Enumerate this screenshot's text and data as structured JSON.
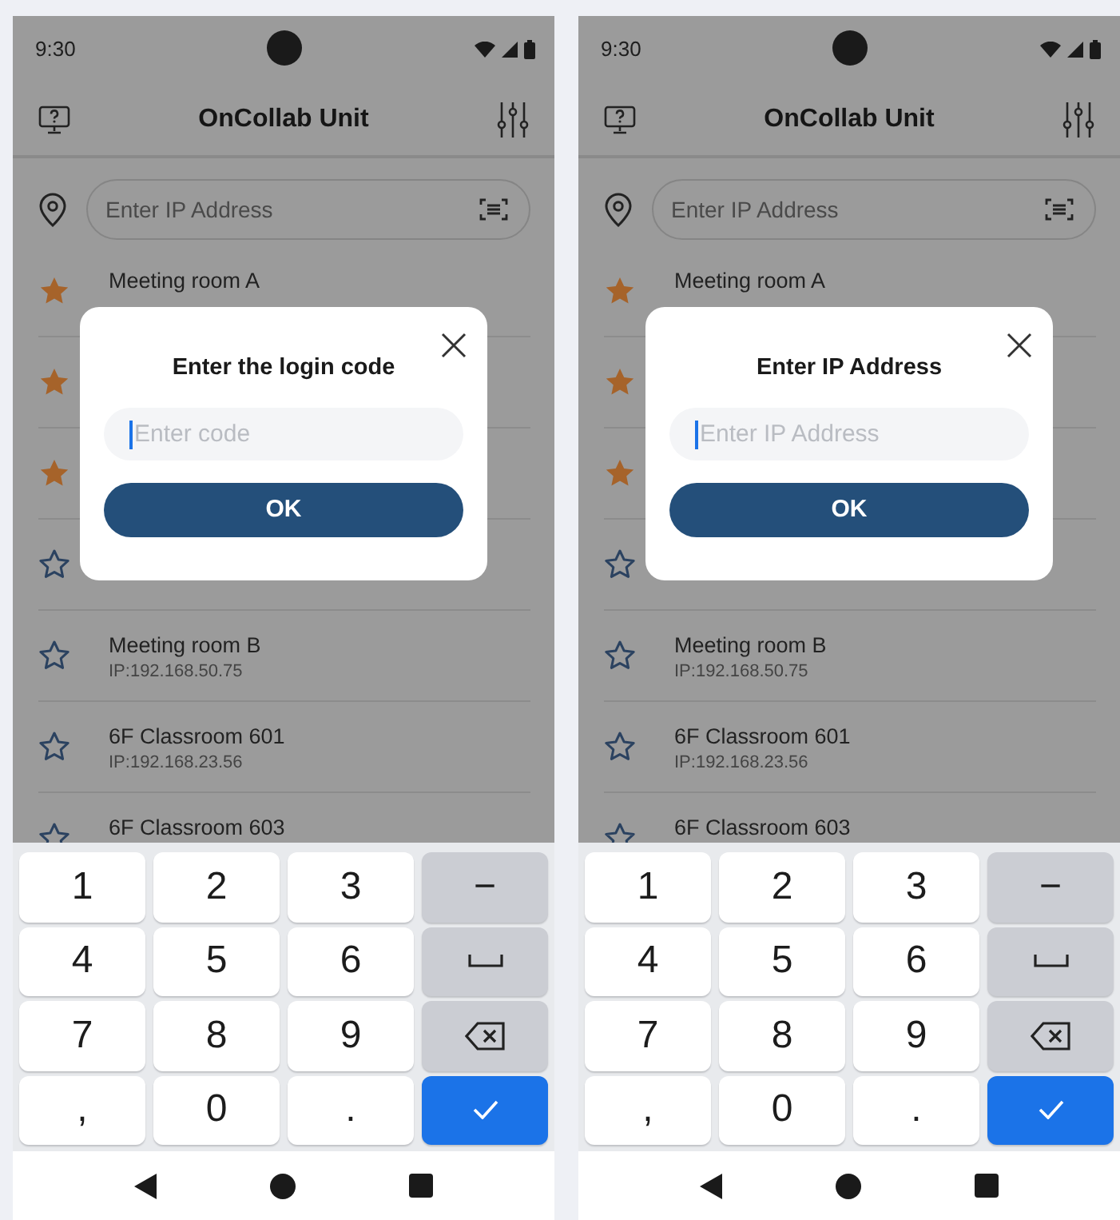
{
  "screens": [
    {
      "status_bar": {
        "time": "9:30"
      },
      "app_bar": {
        "title": "OnCollab Unit"
      },
      "search": {
        "placeholder": "Enter IP Address"
      },
      "devices": [
        {
          "name": "Meeting room A",
          "favorite": true
        },
        {
          "favorite": true
        },
        {
          "favorite": true
        },
        {
          "favorite": false
        },
        {
          "name": "Meeting room B",
          "ip": "IP:192.168.50.75",
          "favorite": false
        },
        {
          "name": "6F Classroom 601",
          "ip": "IP:192.168.23.56",
          "favorite": false
        },
        {
          "name": "6F Classroom 603",
          "favorite": false
        }
      ],
      "dialog": {
        "title": "Enter the login code",
        "placeholder": "Enter code",
        "button": "OK"
      },
      "keyboard": [
        {
          "kind": "char",
          "label": "1"
        },
        {
          "kind": "char",
          "label": "2"
        },
        {
          "kind": "char",
          "label": "3"
        },
        {
          "kind": "symbol",
          "label": "−"
        },
        {
          "kind": "char",
          "label": "4"
        },
        {
          "kind": "char",
          "label": "5"
        },
        {
          "kind": "char",
          "label": "6"
        },
        {
          "kind": "space"
        },
        {
          "kind": "char",
          "label": "7"
        },
        {
          "kind": "char",
          "label": "8"
        },
        {
          "kind": "char",
          "label": "9"
        },
        {
          "kind": "backspace"
        },
        {
          "kind": "char",
          "label": ","
        },
        {
          "kind": "char",
          "label": "0"
        },
        {
          "kind": "char",
          "label": "."
        },
        {
          "kind": "done"
        }
      ]
    },
    {
      "status_bar": {
        "time": "9:30"
      },
      "app_bar": {
        "title": "OnCollab Unit"
      },
      "search": {
        "placeholder": "Enter IP Address"
      },
      "devices": [
        {
          "name": "Meeting room A",
          "favorite": true
        },
        {
          "favorite": true
        },
        {
          "favorite": true
        },
        {
          "favorite": false
        },
        {
          "name": "Meeting room B",
          "ip": "IP:192.168.50.75",
          "favorite": false
        },
        {
          "name": "6F Classroom 601",
          "ip": "IP:192.168.23.56",
          "favorite": false
        },
        {
          "name": "6F Classroom 603",
          "favorite": false
        }
      ],
      "dialog": {
        "title": "Enter IP Address",
        "placeholder": "Enter IP Address",
        "button": "OK"
      },
      "keyboard": [
        {
          "kind": "char",
          "label": "1"
        },
        {
          "kind": "char",
          "label": "2"
        },
        {
          "kind": "char",
          "label": "3"
        },
        {
          "kind": "symbol",
          "label": "−"
        },
        {
          "kind": "char",
          "label": "4"
        },
        {
          "kind": "char",
          "label": "5"
        },
        {
          "kind": "char",
          "label": "6"
        },
        {
          "kind": "space"
        },
        {
          "kind": "char",
          "label": "7"
        },
        {
          "kind": "char",
          "label": "8"
        },
        {
          "kind": "char",
          "label": "9"
        },
        {
          "kind": "backspace"
        },
        {
          "kind": "char",
          "label": ","
        },
        {
          "kind": "char",
          "label": "0"
        },
        {
          "kind": "char",
          "label": "."
        },
        {
          "kind": "done"
        }
      ]
    }
  ]
}
